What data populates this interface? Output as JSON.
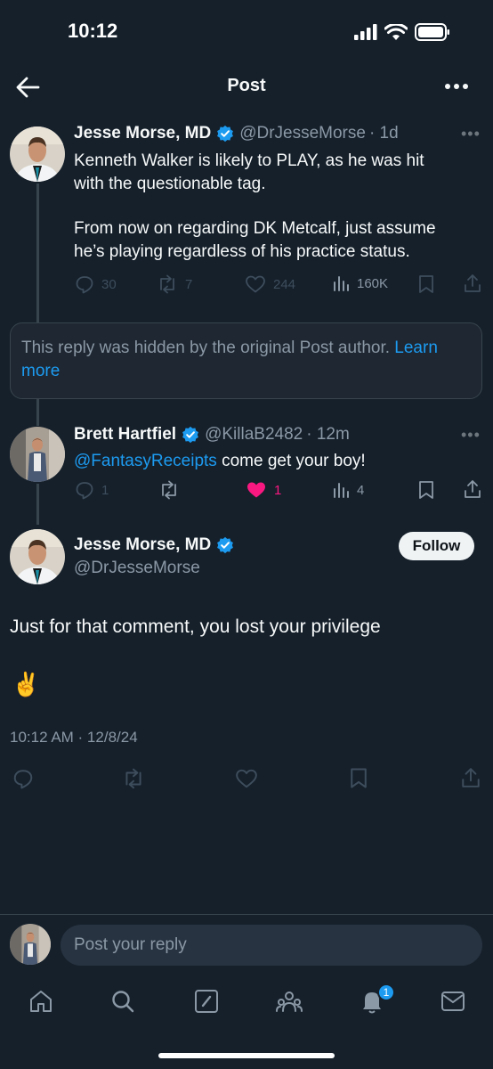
{
  "status_bar": {
    "time": "10:12"
  },
  "header": {
    "title": "Post"
  },
  "parent_post": {
    "author_name": "Jesse Morse, MD",
    "handle": "@DrJesseMorse",
    "age": "· 1d",
    "text_line1": "Kenneth Walker is likely to PLAY, as he was hit",
    "text_line2": "with the questionable tag.",
    "text_line3": "From now on regarding DK Metcalf, just assume",
    "text_line4": "he’s playing regardless of his practice status.",
    "actions": {
      "replies": "30",
      "reposts": "7",
      "likes": "244",
      "views": "160K"
    }
  },
  "hidden_reply": {
    "text": "This reply was hidden by the original Post author.",
    "link_line1": "Learn",
    "link_line2": "more"
  },
  "reply_post": {
    "author_name": "Brett Hartfiel",
    "handle": "@KillaB2482",
    "age": "· 12m",
    "mention": "@FantasyReceipts",
    "text": "come get your boy!",
    "actions": {
      "replies": "1",
      "likes": "1",
      "views": "4"
    }
  },
  "focus_post": {
    "author_name": "Jesse Morse, MD",
    "handle": "@DrJesseMorse",
    "follow_label": "Follow",
    "text": "Just for that comment, you lost your privilege",
    "emoji": "✌️",
    "timestamp": "10:12 AM · 12/8/24"
  },
  "reply_composer": {
    "placeholder": "Post your reply"
  },
  "bottom_nav": {
    "items": [
      "home-icon",
      "search-icon",
      "compose-icon",
      "communities-icon",
      "notifications-icon",
      "messages-icon"
    ],
    "notification_count": "1"
  },
  "colors": {
    "background": "#15202b",
    "accent": "#1d9bf0",
    "like": "#f91880",
    "muted": "#8b98a5"
  }
}
